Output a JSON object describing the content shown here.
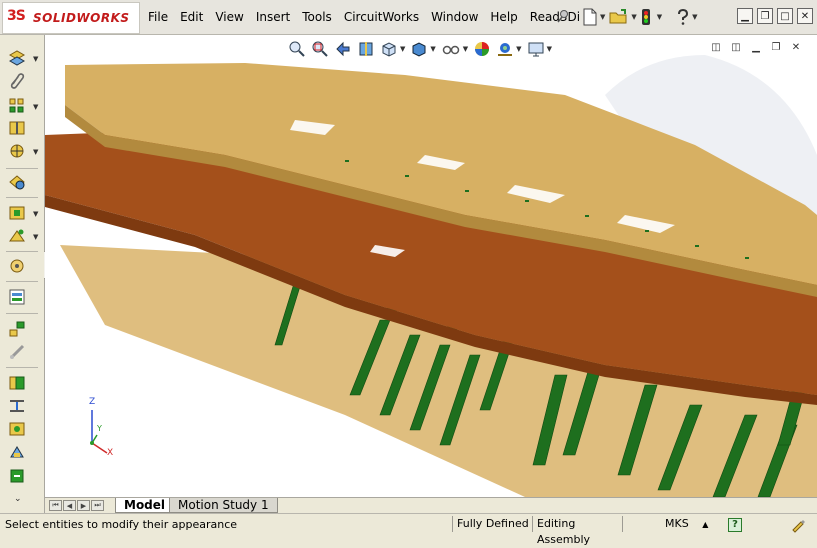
{
  "app": {
    "logo_mark": "3S",
    "logo_text": "SOLIDWORKS"
  },
  "menu": [
    "File",
    "Edit",
    "View",
    "Insert",
    "Tools",
    "CircuitWorks",
    "Window",
    "Help",
    "Read3Di"
  ],
  "toolbar_icons": [
    "new-document",
    "open-folder",
    "traffic-light",
    "help"
  ],
  "window_controls": [
    "minimize",
    "restore",
    "maximize",
    "close"
  ],
  "heads_up_toolbar": [
    "zoom-to-fit",
    "zoom-to-area",
    "previous-view",
    "section-view",
    "view-orientation",
    "display-style",
    "hide-show-items",
    "edit-appearance",
    "apply-scene",
    "view-settings"
  ],
  "left_toolbar": [
    "mate",
    "insert-component",
    "linear-pattern",
    "smart-fasteners",
    "move-component",
    "show-hidden",
    "assembly-features",
    "reference-geometry",
    "new-motion-study",
    "bill-of-materials",
    "exploded-view",
    "explode-line-sketch",
    "interference-detection",
    "clearance-verification",
    "hole-alignment",
    "instant3d"
  ],
  "tabs": {
    "model": "Model",
    "motion": "Motion Study 1"
  },
  "status": {
    "message": "Select entities to modify their appearance",
    "defined": "Fully Defined",
    "mode": "Editing Assembly",
    "units": "MKS",
    "units_arrow": "▲",
    "help": "?"
  },
  "triad": {
    "x": "X",
    "y": "Y",
    "z": "Z"
  },
  "colors": {
    "light_slab": "#d7b063",
    "dark_slab": "#a4501b",
    "pile": "#1e6f1e",
    "sky": "#eef0f4"
  }
}
